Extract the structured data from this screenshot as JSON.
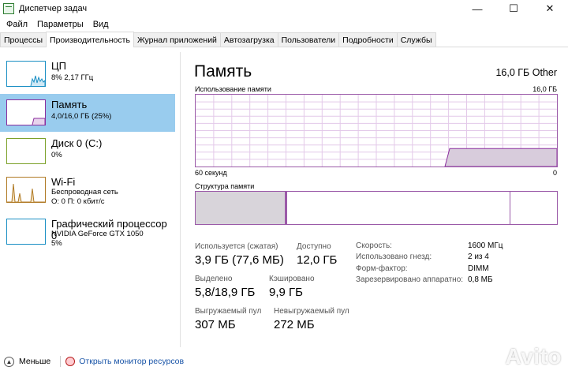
{
  "window": {
    "title": "Диспетчер задач",
    "minimize": "—",
    "maximize": "☐",
    "close": "✕"
  },
  "menu": [
    "Файл",
    "Параметры",
    "Вид"
  ],
  "tabs": [
    {
      "label": "Процессы",
      "active": false
    },
    {
      "label": "Производительность",
      "active": true
    },
    {
      "label": "Журнал приложений",
      "active": false
    },
    {
      "label": "Автозагрузка",
      "active": false
    },
    {
      "label": "Пользователи",
      "active": false
    },
    {
      "label": "Подробности",
      "active": false
    },
    {
      "label": "Службы",
      "active": false
    }
  ],
  "sidebar": {
    "cpu": {
      "title": "ЦП",
      "sub": "8% 2,17 ГГц",
      "color": "#1a8fc4"
    },
    "memory": {
      "title": "Память",
      "sub": "4,0/16,0 ГБ (25%)",
      "color": "#8b2e9e"
    },
    "disk": {
      "title": "Диск 0 (C:)",
      "sub": "0%",
      "color": "#7ca12a"
    },
    "wifi": {
      "title": "Wi-Fi",
      "sub1": "Беспроводная сеть",
      "sub2": "О: 0 П: 0 кбит/с",
      "color": "#b07a24"
    },
    "gpu": {
      "title": "Графический процессор 0",
      "sub1": "NVIDIA GeForce GTX 1050",
      "sub2": "5%",
      "color": "#1a8fc4"
    }
  },
  "main": {
    "heading": "Память",
    "total": "16,0 ГБ Other",
    "usage_label": "Использование памяти",
    "usage_max": "16,0 ГБ",
    "usage_level": 0.25,
    "x_left": "60 секунд",
    "x_right": "0",
    "structure_label": "Структура памяти",
    "stats": {
      "in_use_label": "Используется (сжатая)",
      "in_use_value": "3,9 ГБ (77,6 МБ)",
      "available_label": "Доступно",
      "available_value": "12,0 ГБ",
      "committed_label": "Выделено",
      "committed_value": "5,8/18,9 ГБ",
      "cached_label": "Кэшировано",
      "cached_value": "9,9 ГБ",
      "paged_label": "Выгружаемый пул",
      "paged_value": "307 МБ",
      "nonpaged_label": "Невыгружаемый пул",
      "nonpaged_value": "272 МБ"
    },
    "details": {
      "speed_label": "Скорость:",
      "speed_value": "1600 МГц",
      "slots_label": "Использовано гнезд:",
      "slots_value": "2 из 4",
      "form_label": "Форм-фактор:",
      "form_value": "DIMM",
      "reserved_label": "Зарезервировано аппаратно:",
      "reserved_value": "0,8 МБ"
    }
  },
  "footer": {
    "fewer": "Меньше",
    "monitor": "Открыть монитор ресурсов"
  },
  "watermark": "Avito"
}
